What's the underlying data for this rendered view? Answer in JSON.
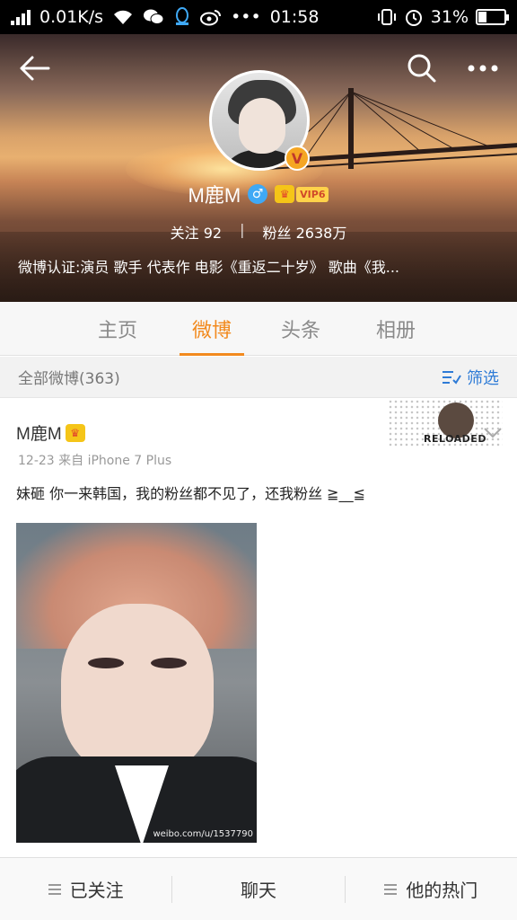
{
  "status_bar": {
    "net_speed": "0.01K/s",
    "time": "01:58",
    "dots": "•••",
    "battery": "31%",
    "battery_level": 0.31
  },
  "profile": {
    "name": "M鹿M",
    "vip_label": "VIP6",
    "stats": {
      "following_label": "关注",
      "following_value": "92",
      "separator": "|",
      "fans_label": "粉丝",
      "fans_value": "2638万"
    },
    "bio": "微博认证:演员 歌手 代表作 电影《重返二十岁》 歌曲《我..."
  },
  "tabs": [
    {
      "label": "主页"
    },
    {
      "label": "微博",
      "active": true
    },
    {
      "label": "头条"
    },
    {
      "label": "相册"
    }
  ],
  "filter": {
    "label": "全部微博(363)",
    "button": "筛选"
  },
  "post": {
    "author": "M鹿M",
    "meta": "12-23  来自 iPhone 7 Plus",
    "text": "妹砸  你一来韩国，我的粉丝都不见了，还我粉丝 ≧__≦",
    "card_badge": "RELOADED",
    "image_watermark": "weibo.com/u/1537790"
  },
  "bottom_bar": {
    "follow": "已关注",
    "chat": "聊天",
    "hot": "他的热门"
  },
  "colors": {
    "accent": "#f28a1e",
    "link_blue": "#2e7bd6",
    "vip_gold": "#ffd24a"
  }
}
